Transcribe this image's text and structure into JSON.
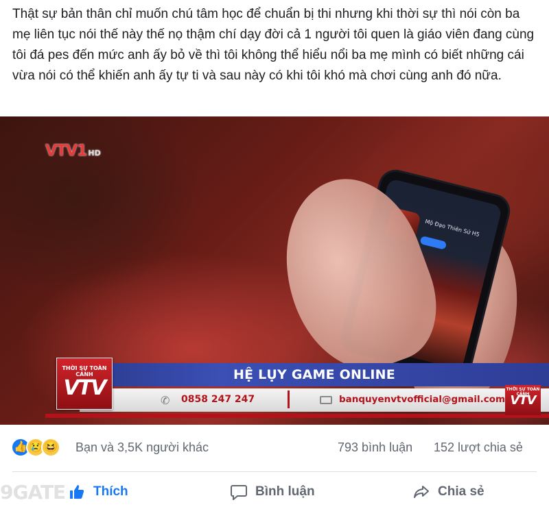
{
  "post": {
    "text": "Thật sự bản thân chỉ muốn chú tâm học để chuẩn bị thi nhưng khi thời sự thì nói còn ba mẹ liên tục nói thế này thế nọ thậm chí dạy đời cả 1 người tôi quen là giáo viên đang cùng tôi đá pes đến mức anh ấy bỏ về thì tôi không thể hiểu nổi ba mẹ mình có biết những cái vừa nói có thể khiến anh ấy tự ti và sau này có khi tôi khó mà chơi cùng anh đó nữa."
  },
  "video": {
    "channel_logo": "VTV1",
    "channel_hd": "HD",
    "program_name": "THỜI SỰ TOÀN CẢNH",
    "program_logo": "VTV",
    "headline": "HỆ LỤY GAME ONLINE",
    "phone": "0858 247 247",
    "separator": "|",
    "email": "banquyenvtvofficial@gmail.com",
    "app_title": "Mộ Đạo Thiên Sử H5"
  },
  "stats": {
    "reactions": [
      "like",
      "sad",
      "haha"
    ],
    "reactors_text": "Bạn và 3,5K người khác",
    "comments_text": "793 bình luận",
    "shares_text": "152 lượt chia sẻ"
  },
  "actions": {
    "like_label": "Thích",
    "comment_label": "Bình luận",
    "share_label": "Chia sẻ"
  },
  "watermark": "9GATE",
  "colors": {
    "facebook_blue": "#1877f2",
    "text_gray": "#606770",
    "vtv_red": "#b3121b",
    "headline_blue": "#2e3d96"
  }
}
